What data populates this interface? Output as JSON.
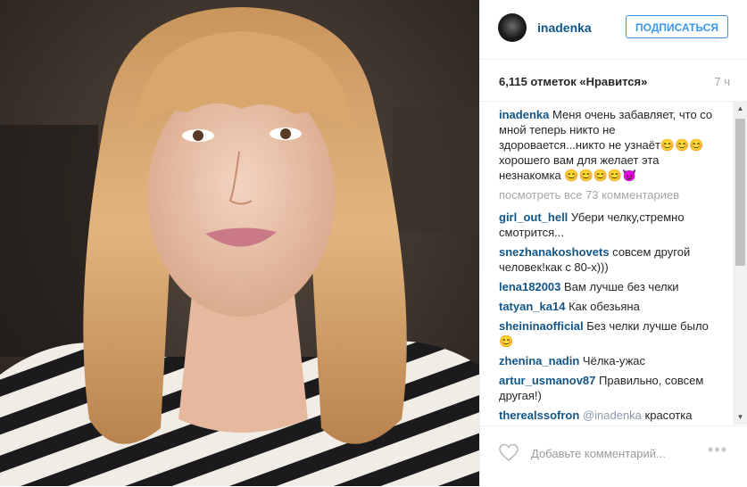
{
  "post": {
    "username": "inadenka",
    "follow_label": "ПОДПИСАТЬСЯ",
    "likes_text": "6,115 отметок «Нравится»",
    "time_text": "7 ч",
    "caption": "Меня очень забавляет, что со мной теперь никто не здоровается...никто не узнаёт😊😊😊 хорошего вам для желает эта незнакомка 😊😊😊😊😈",
    "view_all_text": "посмотреть все 73 комментариев",
    "comment_placeholder": "Добавьте комментарий...",
    "more_label": "•••"
  },
  "comments": [
    {
      "user": "girl_out_hell",
      "text": "Убери челку,стремно смотрится..."
    },
    {
      "user": "snezhanakoshovets",
      "text": "совсем другой человек!как с 80-х)))"
    },
    {
      "user": "lena182003",
      "text": "Вам лучше без челки"
    },
    {
      "user": "tatyan_ka14",
      "text": "Как обезьяна"
    },
    {
      "user": "sheininaofficial",
      "text": "Без челки лучше было 😊"
    },
    {
      "user": "zhenina_nadin",
      "text": "Чёлка-ужас"
    },
    {
      "user": "artur_usmanov87",
      "text": "Правильно, совсем другая!)"
    },
    {
      "user": "therealssofron",
      "mention": "@inadenka",
      "text": "красотка никого не слушай!!!)"
    }
  ],
  "colors": {
    "username": "#125688",
    "accent": "#3897f0",
    "muted": "#a5a7aa"
  },
  "icons": {
    "heart": "heart-icon",
    "more": "more-options-icon"
  }
}
